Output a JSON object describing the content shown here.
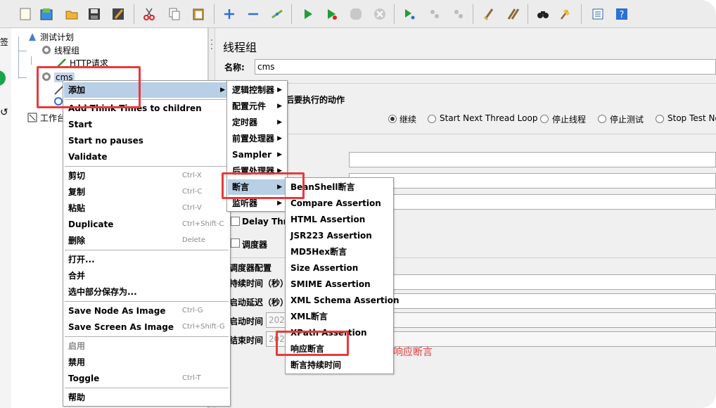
{
  "strip": {
    "tag": "签"
  },
  "tree": {
    "root": "测试计划",
    "thread_group": "线程组",
    "http_request": "HTTP请求",
    "cms": "cms",
    "workbench": "工作台"
  },
  "right_panel": {
    "title": "线程组",
    "name_label": "名称:",
    "name_value": "cms",
    "error_action_title": "后要执行的动作",
    "radios": [
      "继续",
      "Start Next Thread Loop",
      "停止线程",
      "停止测试",
      "Stop Test Now"
    ],
    "delay_label": "Delay Thread",
    "scheduler_label": "调度器",
    "scheduler_config": "调度器配置",
    "duration_label": "持续时间（秒）",
    "startup_delay_label": "启动延迟（秒）",
    "start_time_label": "启动时间",
    "end_time_label": "结束时间",
    "start_time_value": "202",
    "end_time_value": "202"
  },
  "context_menu": {
    "add": "添加",
    "think_times": "Add Think Times to children",
    "start": "Start",
    "start_no_pauses": "Start no pauses",
    "validate": "Validate",
    "cut": "剪切",
    "cut_sc": "Ctrl-X",
    "copy": "复制",
    "copy_sc": "Ctrl-C",
    "paste": "粘贴",
    "paste_sc": "Ctrl-V",
    "duplicate": "Duplicate",
    "duplicate_sc": "Ctrl+Shift-C",
    "delete": "删除",
    "delete_sc": "Delete",
    "open": "打开...",
    "merge": "合并",
    "save_selection": "选中部分保存为...",
    "save_node_image": "Save Node As Image",
    "save_node_image_sc": "Ctrl-G",
    "save_screen_image": "Save Screen As Image",
    "save_screen_image_sc": "Ctrl+Shift-G",
    "enable": "启用",
    "disable": "禁用",
    "toggle": "Toggle",
    "toggle_sc": "Ctrl-T",
    "help": "帮助"
  },
  "submenu_add": [
    "逻辑控制器",
    "配置元件",
    "定时器",
    "前置处理器",
    "Sampler",
    "后置处理器",
    "断言",
    "监听器"
  ],
  "submenu_assertions": [
    "BeanShell断言",
    "Compare Assertion",
    "HTML Assertion",
    "JSR223 Assertion",
    "MD5Hex断言",
    "Size Assertion",
    "SMIME Assertion",
    "XML Schema Assertion",
    "XML断言",
    "XPath Assertion",
    "响应断言",
    "断言持续时间"
  ],
  "annotation": "响应断言",
  "colors": {
    "highlight": "#b8cfe5",
    "red_box": "#e83a3a",
    "toolbar_green": "#1e9e3a",
    "toolbar_blue": "#2d6fd6"
  }
}
